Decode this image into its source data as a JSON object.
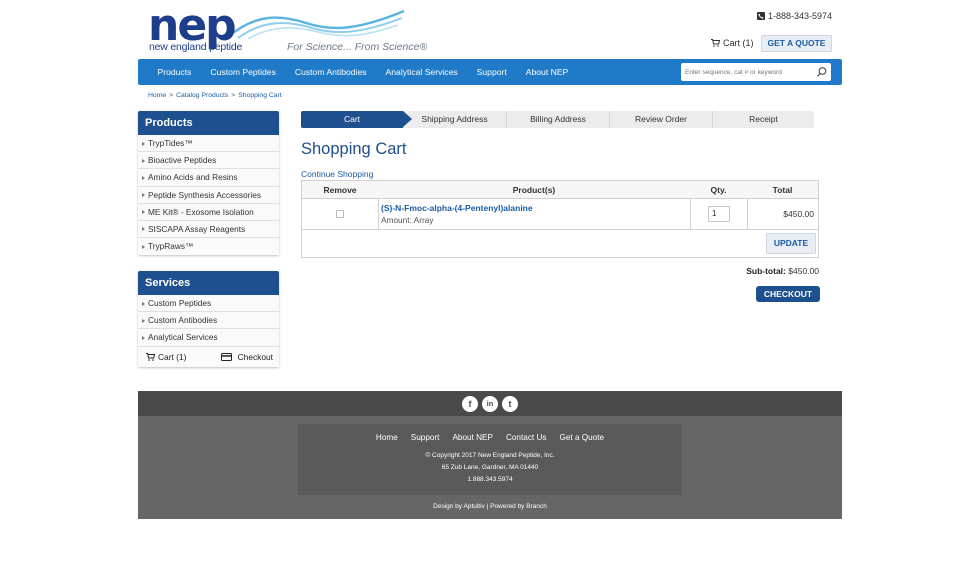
{
  "header": {
    "logo_text": "nep",
    "logo_sub": "new england peptide",
    "tagline": "For Science... From Science®",
    "phone": "1-888-343-5974",
    "cart_label": "Cart (1)",
    "quote_button": "GET A QUOTE"
  },
  "nav": {
    "items": [
      "Products",
      "Custom Peptides",
      "Custom Antibodies",
      "Analytical Services",
      "Support",
      "About NEP"
    ],
    "search_placeholder": "Enter sequence, cat # or keyword"
  },
  "breadcrumb": [
    "Home",
    "Catalog Products",
    "Shopping Cart"
  ],
  "sidebar": {
    "products_title": "Products",
    "products": [
      "TrypTides™",
      "Bioactive Peptides",
      "Amino Acids and Resins",
      "Peptide Synthesis Accessories",
      "ME Kit® - Exosome Isolation",
      "SISCAPA Assay Reagents",
      "TrypRaws™"
    ],
    "services_title": "Services",
    "services": [
      "Custom Peptides",
      "Custom Antibodies",
      "Analytical Services"
    ],
    "cart_label": "Cart (1)",
    "checkout_label": "Checkout"
  },
  "steps": [
    "Cart",
    "Shipping Address",
    "Billing Address",
    "Review Order",
    "Receipt"
  ],
  "page": {
    "title": "Shopping Cart",
    "continue_link": "Continue Shopping"
  },
  "cart": {
    "headers": [
      "Remove",
      "Product(s)",
      "Qty.",
      "Total"
    ],
    "item": {
      "name": "(S)-N-Fmoc-alpha-(4-Pentenyl)alanine",
      "amount": "Amount: Array",
      "qty": "1",
      "total": "$450.00"
    },
    "update_button": "UPDATE",
    "subtotal_label": "Sub-total:",
    "subtotal_value": "$450.00",
    "checkout_button": "CHECKOUT"
  },
  "footer": {
    "social": [
      "f",
      "in",
      "t"
    ],
    "links": [
      "Home",
      "Support",
      "About NEP",
      "Contact Us",
      "Get a Quote"
    ],
    "copyright": "© Copyright 2017 New England Peptide, Inc.",
    "address": "65 Zub Lane, Gardner, MA 01440",
    "phone": "1.888.343.5974",
    "credit": "Design by Aptuitiv | Powered by Branch"
  },
  "colors": {
    "brand_dark": "#1e4f8f",
    "nav_blue": "#1f7ac8",
    "link_blue": "#1a5ca8",
    "footer_grey": "#666666"
  }
}
